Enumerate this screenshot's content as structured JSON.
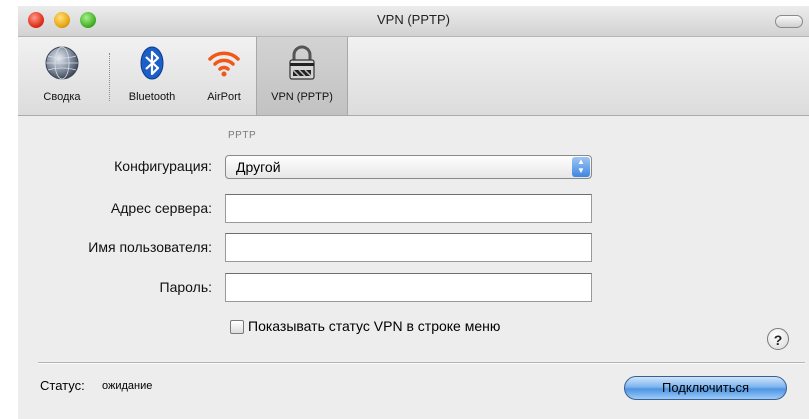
{
  "window": {
    "title": "VPN (PPTP)"
  },
  "toolbar": {
    "items": [
      {
        "label": "Сводка",
        "icon": "globe-icon"
      },
      {
        "label": "Bluetooth",
        "icon": "bluetooth-icon"
      },
      {
        "label": "AirPort",
        "icon": "airport-wifi-icon"
      },
      {
        "label": "VPN (PPTP)",
        "icon": "lock-icon",
        "selected": true
      }
    ]
  },
  "section": {
    "label": "PPTP"
  },
  "form": {
    "configuration_label": "Конфигурация:",
    "configuration_value": "Другой",
    "server_label": "Адрес сервера:",
    "server_value": "",
    "username_label": "Имя пользователя:",
    "username_value": "",
    "password_label": "Пароль:",
    "password_value": "",
    "show_status_label": "Показывать статус VPN в строке меню",
    "show_status_checked": false
  },
  "help": {
    "symbol": "?"
  },
  "status": {
    "label": "Статус:",
    "value": "ожидание"
  },
  "actions": {
    "connect_label": "Подключиться"
  },
  "colors": {
    "accent": "#4d95e4",
    "window_bg": "#ededed"
  }
}
